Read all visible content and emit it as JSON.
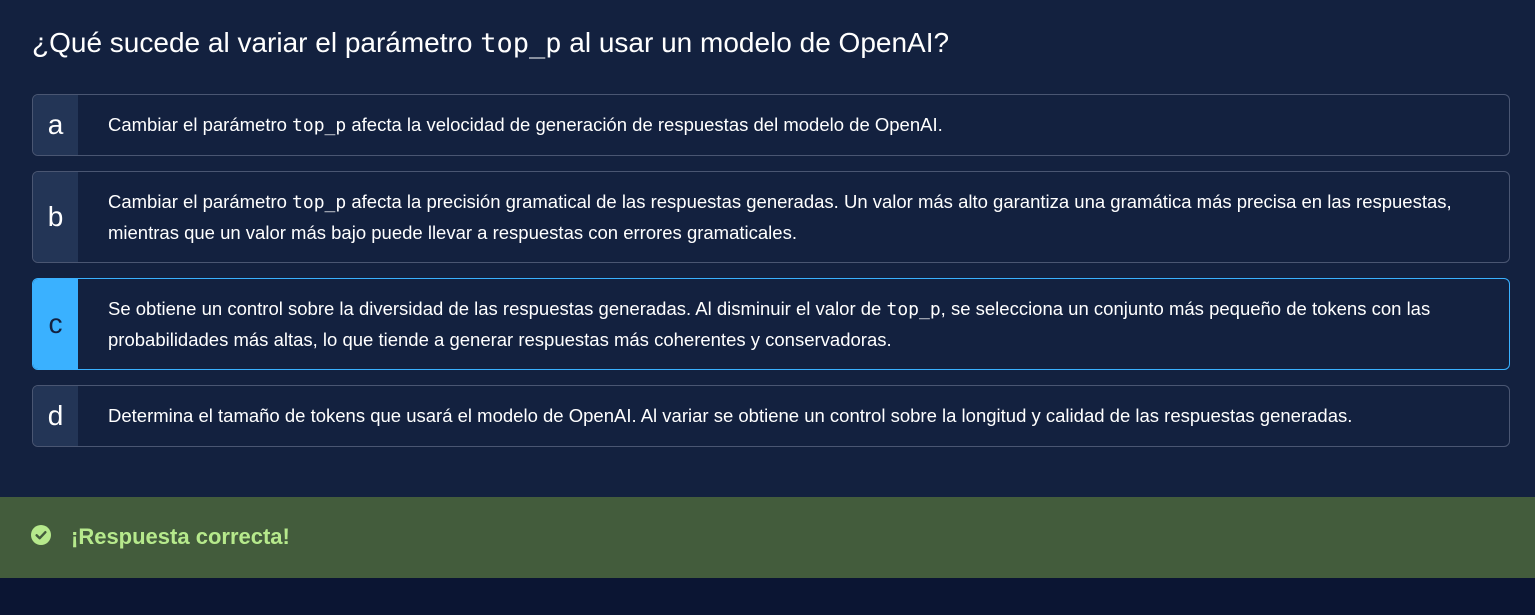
{
  "question": {
    "prefix": "¿Qué sucede al variar el parámetro ",
    "code": "top_p",
    "suffix": " al usar un modelo de OpenAI?"
  },
  "options": [
    {
      "letter": "a",
      "prefix": "Cambiar el parámetro ",
      "code": "top_p",
      "suffix": " afecta la velocidad de generación de respuestas del modelo de OpenAI."
    },
    {
      "letter": "b",
      "prefix": "Cambiar el parámetro ",
      "code": "top_p",
      "suffix": " afecta la precisión gramatical de las respuestas generadas. Un valor más alto garantiza una gramática más precisa en las respuestas, mientras que un valor más bajo puede llevar a respuestas con errores gramaticales."
    },
    {
      "letter": "c",
      "selected": true,
      "prefix": "Se obtiene un control sobre la diversidad de las respuestas generadas. Al disminuir el valor de ",
      "code": "top_p",
      "suffix": ", se selecciona un conjunto más pequeño de tokens con las probabilidades más altas, lo que tiende a generar respuestas más coherentes y conservadoras."
    },
    {
      "letter": "d",
      "text": "Determina el tamaño de tokens que usará el modelo de OpenAI. Al variar se obtiene un control sobre la longitud y calidad de las respuestas generadas."
    }
  ],
  "feedback": {
    "icon": "check-circle-icon",
    "text": "¡Respuesta correcta!",
    "background": "#435c3c",
    "text_color": "#b6e98c"
  },
  "colors": {
    "panel_background": "#13213f",
    "page_background": "#0b1533",
    "selected_accent": "#3ab1ff",
    "option_border": "#4a5672",
    "letter_background": "#233556"
  }
}
